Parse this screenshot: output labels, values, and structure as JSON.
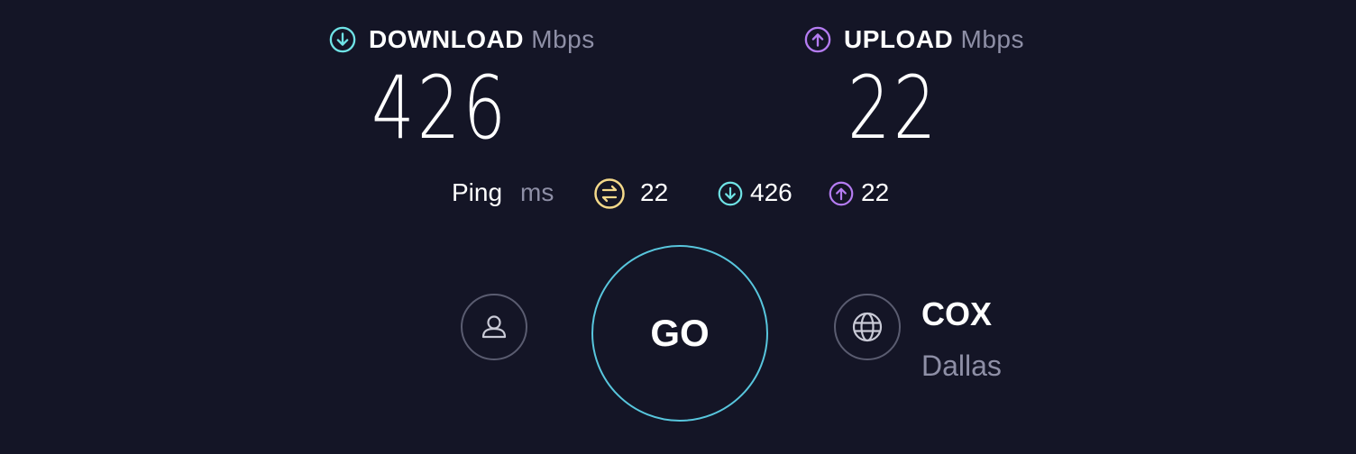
{
  "colors": {
    "background": "#141526",
    "download": "#6fe3e6",
    "upload": "#b57cf2",
    "ping": "#f4d98a",
    "go_ring": "#58c6dd",
    "muted": "#8e8fa6"
  },
  "download": {
    "label": "DOWNLOAD",
    "unit": "Mbps",
    "value": "426",
    "icon": "arrow-down-circle-icon"
  },
  "upload": {
    "label": "UPLOAD",
    "unit": "Mbps",
    "value": "22",
    "icon": "arrow-up-circle-icon"
  },
  "ping": {
    "label": "Ping",
    "unit": "ms",
    "value": "22",
    "download_value": "426",
    "upload_value": "22"
  },
  "go_button": {
    "label": "GO"
  },
  "provider": {
    "name": "COX",
    "location": "Dallas"
  },
  "icons": {
    "profile": "user-icon",
    "server": "globe-icon",
    "ping": "ping-icon"
  }
}
